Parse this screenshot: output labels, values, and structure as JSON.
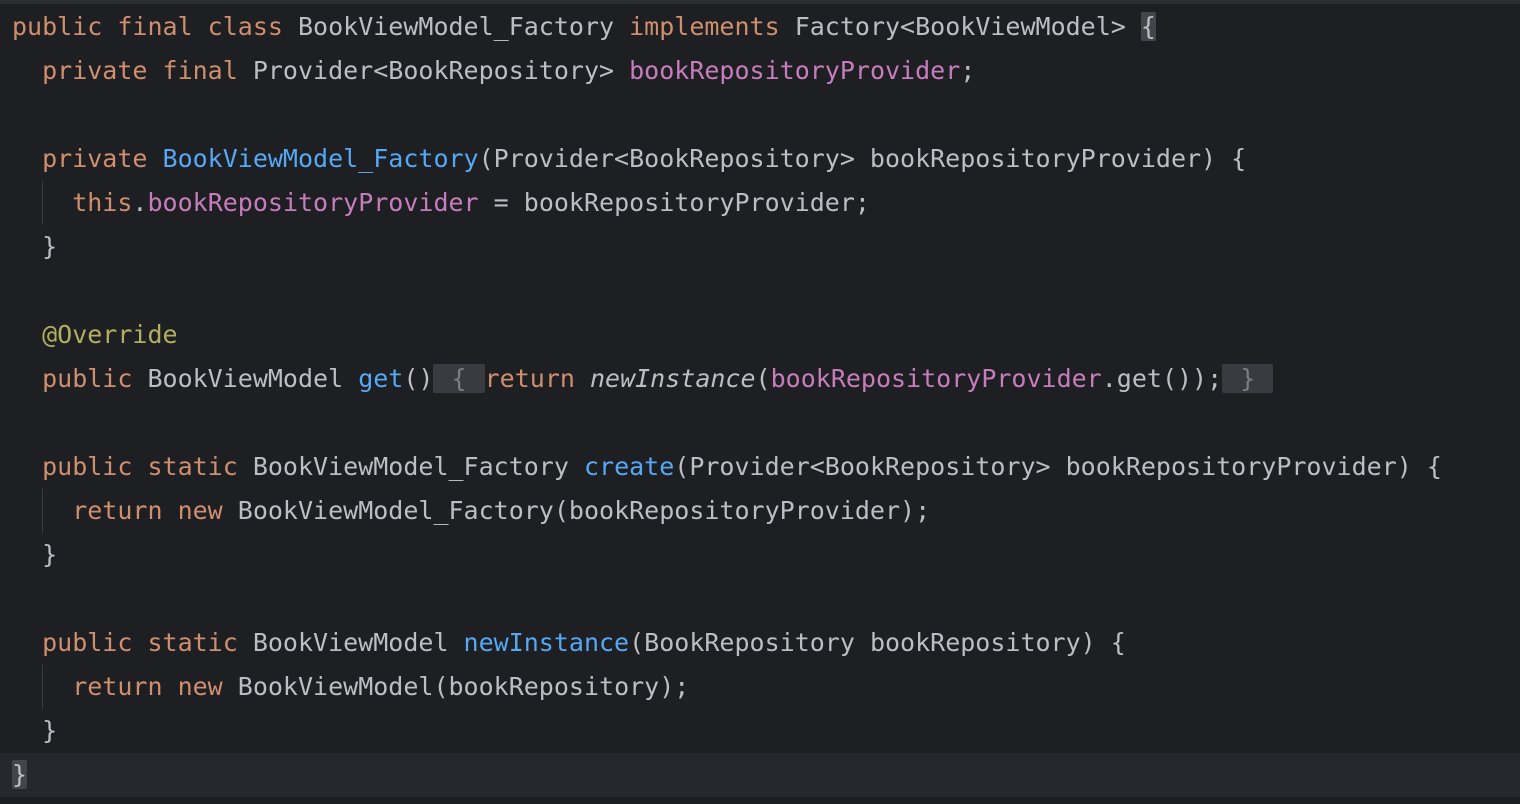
{
  "colors": {
    "background": "#1e1f22",
    "keyword": "#cf8e6d",
    "method": "#56a8f5",
    "field": "#c77dbb",
    "annotation": "#b3ae60",
    "plain": "#bcbec4"
  },
  "lines": [
    [
      {
        "t": "public final class ",
        "c": "kw"
      },
      {
        "t": "BookViewModel_Factory ",
        "c": "plain"
      },
      {
        "t": "implements ",
        "c": "kw"
      },
      {
        "t": "Factory<BookViewModel> ",
        "c": "plain"
      },
      {
        "t": "{",
        "c": "brace-hl"
      }
    ],
    [
      {
        "t": "  private final ",
        "c": "kw"
      },
      {
        "t": "Provider<BookRepository> ",
        "c": "plain"
      },
      {
        "t": "bookRepositoryProvider",
        "c": "field"
      },
      {
        "t": ";",
        "c": "plain"
      }
    ],
    [],
    [
      {
        "t": "  private ",
        "c": "kw"
      },
      {
        "t": "BookViewModel_Factory",
        "c": "fn"
      },
      {
        "t": "(Provider<BookRepository> bookRepositoryProvider) {",
        "c": "plain"
      }
    ],
    [
      {
        "t": "    this",
        "c": "kw"
      },
      {
        "t": ".",
        "c": "plain"
      },
      {
        "t": "bookRepositoryProvider",
        "c": "field"
      },
      {
        "t": " = bookRepositoryProvider;",
        "c": "plain"
      }
    ],
    [
      {
        "t": "  }",
        "c": "plain"
      }
    ],
    [],
    [
      {
        "t": "  @Override",
        "c": "ann"
      }
    ],
    [
      {
        "t": "  public ",
        "c": "kw"
      },
      {
        "t": "BookViewModel ",
        "c": "plain"
      },
      {
        "t": "get",
        "c": "fn"
      },
      {
        "t": "()",
        "c": "plain"
      },
      {
        "t": " { ",
        "c": "fold"
      },
      {
        "t": "return ",
        "c": "kw"
      },
      {
        "t": "newInstance",
        "c": "plain italic"
      },
      {
        "t": "(",
        "c": "plain"
      },
      {
        "t": "bookRepositoryProvider",
        "c": "field"
      },
      {
        "t": ".get());",
        "c": "plain"
      },
      {
        "t": " } ",
        "c": "fold"
      }
    ],
    [],
    [
      {
        "t": "  public static ",
        "c": "kw"
      },
      {
        "t": "BookViewModel_Factory ",
        "c": "plain"
      },
      {
        "t": "create",
        "c": "fn"
      },
      {
        "t": "(Provider<BookRepository> bookRepositoryProvider) {",
        "c": "plain"
      }
    ],
    [
      {
        "t": "    return new ",
        "c": "kw"
      },
      {
        "t": "BookViewModel_Factory(bookRepositoryProvider);",
        "c": "plain"
      }
    ],
    [
      {
        "t": "  }",
        "c": "plain"
      }
    ],
    [],
    [
      {
        "t": "  public static ",
        "c": "kw"
      },
      {
        "t": "BookViewModel ",
        "c": "plain"
      },
      {
        "t": "newInstance",
        "c": "fn"
      },
      {
        "t": "(BookRepository bookRepository) {",
        "c": "plain"
      }
    ],
    [
      {
        "t": "    return new ",
        "c": "kw"
      },
      {
        "t": "BookViewModel(bookRepository);",
        "c": "plain"
      }
    ],
    [
      {
        "t": "  }",
        "c": "plain"
      }
    ],
    [
      {
        "t": "}",
        "c": "brace-hl"
      }
    ]
  ]
}
